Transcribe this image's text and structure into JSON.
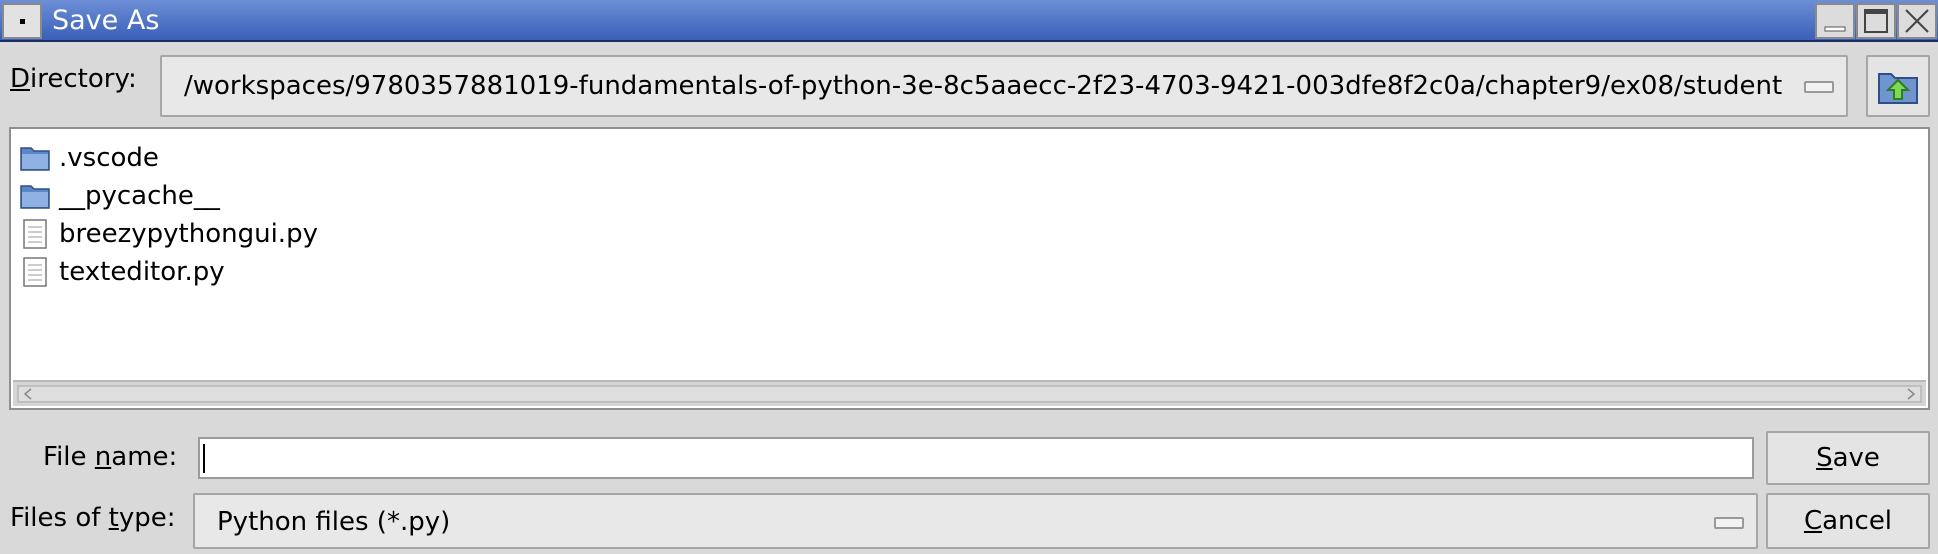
{
  "window": {
    "title": "Save As"
  },
  "directory": {
    "label_pre": "",
    "label_u": "D",
    "label_post": "irectory:",
    "path": "/workspaces/9780357881019-fundamentals-of-python-3e-8c5aaecc-2f23-4703-9421-003dfe8f2c0a/chapter9/ex08/student"
  },
  "files": [
    {
      "name": ".vscode",
      "type": "folder"
    },
    {
      "name": "__pycache__",
      "type": "folder"
    },
    {
      "name": "breezypythongui.py",
      "type": "file"
    },
    {
      "name": "texteditor.py",
      "type": "file"
    }
  ],
  "filename": {
    "label_pre": "File ",
    "label_u": "n",
    "label_post": "ame:",
    "value": ""
  },
  "filetype": {
    "label_pre": "Files of ",
    "label_u": "t",
    "label_post": "ype:",
    "selected": "Python files (*.py)"
  },
  "buttons": {
    "save_u": "S",
    "save_rest": "ave",
    "cancel_u": "C",
    "cancel_rest": "ancel"
  },
  "icons": {
    "folder": "folder-icon",
    "file": "file-icon",
    "up": "up-folder-icon"
  },
  "colors": {
    "titlebar": "#4a6fc4",
    "folder": "#5b86c8"
  }
}
